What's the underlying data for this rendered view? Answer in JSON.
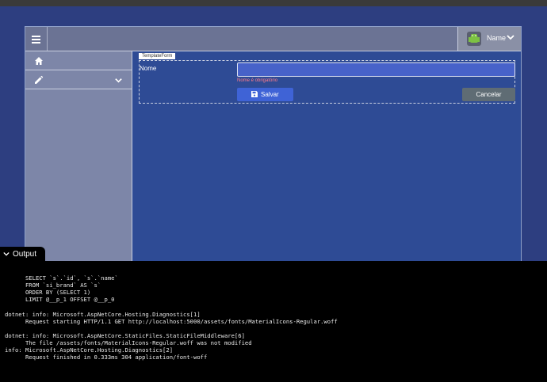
{
  "header": {
    "user_name": "Name"
  },
  "content": {
    "template_label": "TemplateForm",
    "form": {
      "field_label": "Nome",
      "field_value": "",
      "error_text": "Nome é obrigatório",
      "save_label": "Salvar",
      "cancel_label": "Cancelar"
    }
  },
  "output": {
    "tab_label": "Output",
    "lines": [
      "      SELECT `s`.`id`, `s`.`name`",
      "      FROM `si_brand` AS `s`",
      "      ORDER BY (SELECT 1)",
      "      LIMIT @__p_1 OFFSET @__p_0",
      "",
      "dotnet: info: Microsoft.AspNetCore.Hosting.Diagnostics[1]",
      "      Request starting HTTP/1.1 GET http://localhost:5000/assets/fonts/MaterialIcons-Regular.woff",
      "",
      "dotnet: info: Microsoft.AspNetCore.StaticFiles.StaticFileMiddleware[6]",
      "      The file /assets/fonts/MaterialIcons-Regular.woff was not modified",
      "info: Microsoft.AspNetCore.Hosting.Diagnostics[2]",
      "      Request finished in 0.333ms 304 application/font-woff"
    ]
  },
  "icons": {
    "menu": "menu-icon",
    "avatar": "android-avatar-icon",
    "user_chevron": "chevron-down-icon",
    "home": "home-icon",
    "edit": "pencil-icon",
    "sidebar_chevron": "chevron-down-icon",
    "save": "floppy-disk-icon",
    "output_chevron": "chevron-down-icon"
  },
  "colors": {
    "background": "#2d3e80",
    "header": "#6b7394",
    "sidebar": "#7d86a8",
    "input": "#4762c9",
    "save_button": "#3f63d6",
    "cancel_button": "#5f6c74",
    "error": "#ff7b8a",
    "avatar_green": "#7dc243"
  }
}
